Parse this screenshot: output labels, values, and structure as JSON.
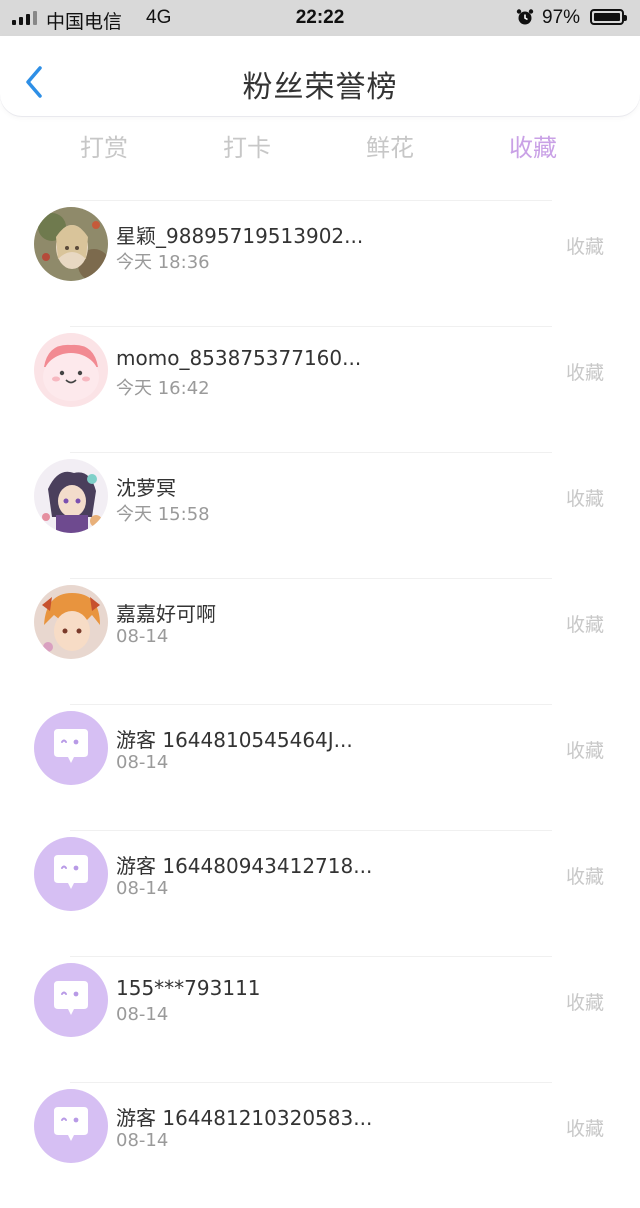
{
  "status_bar": {
    "carrier": "中国电信",
    "network": "4G",
    "time": "22:22",
    "battery": "97%"
  },
  "header": {
    "title": "粉丝荣誉榜"
  },
  "tabs": [
    {
      "label": "打赏",
      "active": false
    },
    {
      "label": "打卡",
      "active": false
    },
    {
      "label": "鲜花",
      "active": false
    },
    {
      "label": "收藏",
      "active": true
    }
  ],
  "colors": {
    "accent": "#c9a1e6",
    "back_icon": "#2e8fe6",
    "guest_avatar_bg": "#d6bff3"
  },
  "list": [
    {
      "name": "星颖_98895719513902...",
      "date": "今天 18:36",
      "action": "收藏",
      "avatar": "anime-avatar-1"
    },
    {
      "name": "momo_853875377160...",
      "date": "今天 16:42",
      "action": "收藏",
      "avatar": "pink-blob-avatar"
    },
    {
      "name": "沈萝冥",
      "date": "今天 15:58",
      "action": "收藏",
      "avatar": "anime-avatar-2"
    },
    {
      "name": "嘉嘉好可啊",
      "date": "08-14",
      "action": "收藏",
      "avatar": "anime-avatar-3"
    },
    {
      "name": "游客 1644810545464J...",
      "date": "08-14",
      "action": "收藏",
      "avatar": "default-chat-avatar"
    },
    {
      "name": "游客 164480943412718...",
      "date": "08-14",
      "action": "收藏",
      "avatar": "default-chat-avatar"
    },
    {
      "name": "155***793111",
      "date": "08-14",
      "action": "收藏",
      "avatar": "default-chat-avatar"
    },
    {
      "name": "游客 164481210320583...",
      "date": "08-14",
      "action": "收藏",
      "avatar": "default-chat-avatar"
    }
  ]
}
